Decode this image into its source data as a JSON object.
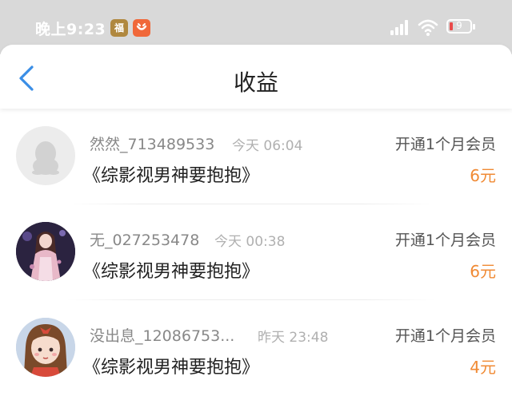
{
  "status_bar": {
    "time": "晚上9:23",
    "app_badge_1": "福",
    "battery_level": "9",
    "colors": {
      "background": "#d9d9d9",
      "battery_low": "#e94b4b"
    },
    "icons": [
      "fu-app-icon",
      "taobao-app-icon",
      "signal-icon",
      "wifi-icon",
      "battery-icon"
    ]
  },
  "header": {
    "title": "收益",
    "back_icon": "chevron-left-icon",
    "accent_color": "#3a8ee6"
  },
  "earnings": [
    {
      "username": "然然_713489533",
      "time": "今天 06:04",
      "book": "《综影视男神要抱抱》",
      "event": "开通1个月会员",
      "amount": "6元",
      "avatar": "default-penguin-avatar"
    },
    {
      "username": "无_027253478",
      "time": "今天 00:38",
      "book": "《综影视男神要抱抱》",
      "event": "开通1个月会员",
      "amount": "6元",
      "avatar": "anime-girl-avatar"
    },
    {
      "username": "没出息_12086753...",
      "time": "昨天 23:48",
      "book": "《综影视男神要抱抱》",
      "event": "开通1个月会员",
      "amount": "4元",
      "avatar": "cartoon-girl-avatar"
    }
  ],
  "colors": {
    "amount": "#f08a34",
    "text_primary": "#222222",
    "text_secondary": "#888888"
  }
}
